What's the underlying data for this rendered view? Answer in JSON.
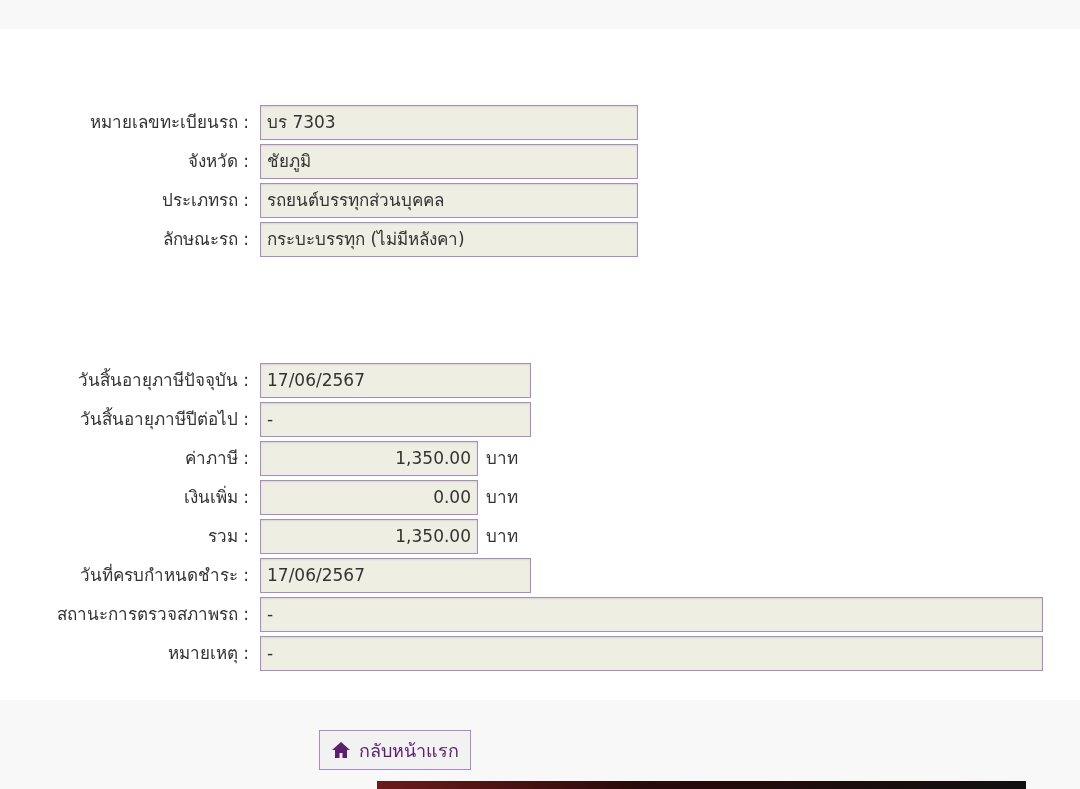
{
  "vehicle_fields": [
    {
      "label": "หมายเลขทะเบียนรถ :",
      "value": "บร 7303",
      "kind": "wide"
    },
    {
      "label": "จังหวัด :",
      "value": "ชัยภูมิ",
      "kind": "wide"
    },
    {
      "label": "ประเภทรถ :",
      "value": "รถยนต์บรรทุกส่วนบุคคล",
      "kind": "wide"
    },
    {
      "label": "ลักษณะรถ :",
      "value": "กระบะบรรทุก (ไม่มีหลังคา)",
      "kind": "wide"
    }
  ],
  "tax_fields": [
    {
      "label": "วันสิ้นอายุภาษีปัจจุบัน :",
      "value": "17/06/2567",
      "kind": "date"
    },
    {
      "label": "วันสิ้นอายุภาษีปีต่อไป :",
      "value": "-",
      "kind": "date"
    },
    {
      "label": "ค่าภาษี :",
      "value": "1,350.00",
      "kind": "money",
      "unit": "บาท"
    },
    {
      "label": "เงินเพิ่ม :",
      "value": "0.00",
      "kind": "money",
      "unit": "บาท"
    },
    {
      "label": "รวม :",
      "value": "1,350.00",
      "kind": "money",
      "unit": "บาท"
    },
    {
      "label": "วันที่ครบกำหนดชำระ :",
      "value": "17/06/2567",
      "kind": "date"
    },
    {
      "label": "สถานะการตรวจสภาพรถ :",
      "value": "-",
      "kind": "full"
    },
    {
      "label": "หมายเหตุ :",
      "value": "-",
      "kind": "full"
    }
  ],
  "home_button": {
    "label": "กลับหน้าแรก"
  }
}
